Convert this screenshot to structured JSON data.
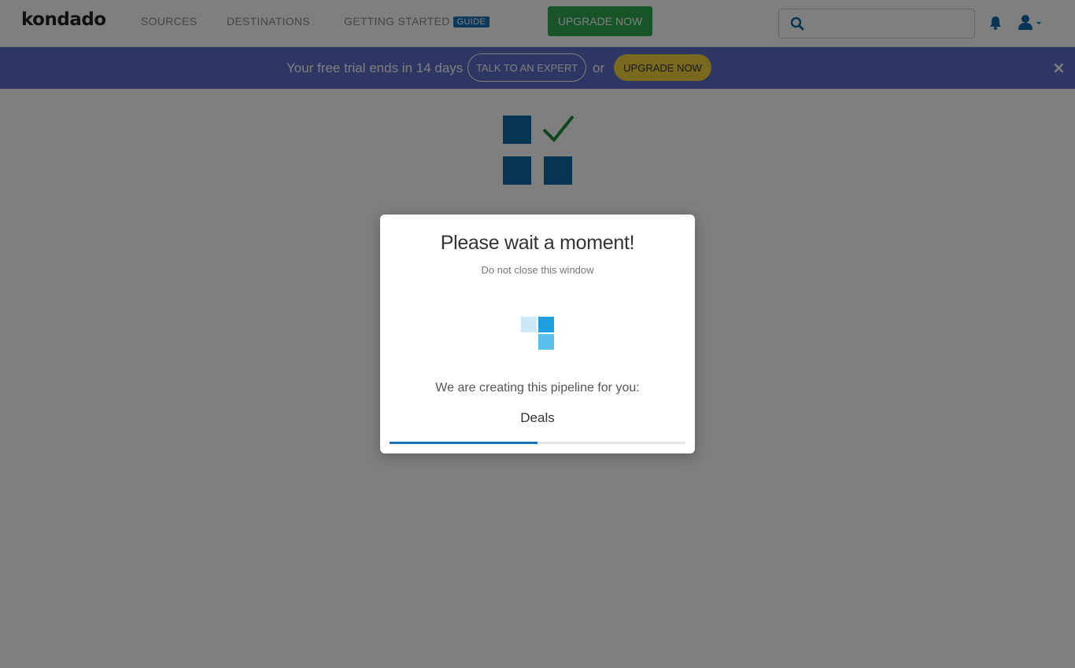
{
  "brand": {
    "logo_text": "kondado"
  },
  "nav": {
    "sources": "SOURCES",
    "destinations": "DESTINATIONS",
    "getting_started": "GETTING STARTED",
    "guide_badge": "GUIDE",
    "upgrade_now": "UPGRADE NOW",
    "search_value": "",
    "search_placeholder": ""
  },
  "banner": {
    "text": "Your free trial ends in 14 days",
    "talk_button": "TALK TO AN EXPERT",
    "or": "or",
    "upgrade_button": "UPGRADE NOW",
    "close": "×"
  },
  "modal": {
    "title": "Please wait a moment!",
    "subtitle": "Do not close this window",
    "creating_text": "We are creating this pipeline for you:",
    "pipeline_name": "Deals",
    "progress_percent": 50
  },
  "colors": {
    "brand_blue": "#0a6aa6",
    "green": "#2ea84f",
    "banner": "#5c6cc6",
    "yellow": "#f2d33a"
  },
  "icons": [
    "search-icon",
    "bell-icon",
    "user-icon",
    "close-icon",
    "pipeline-logo-icon",
    "loader-icon"
  ]
}
